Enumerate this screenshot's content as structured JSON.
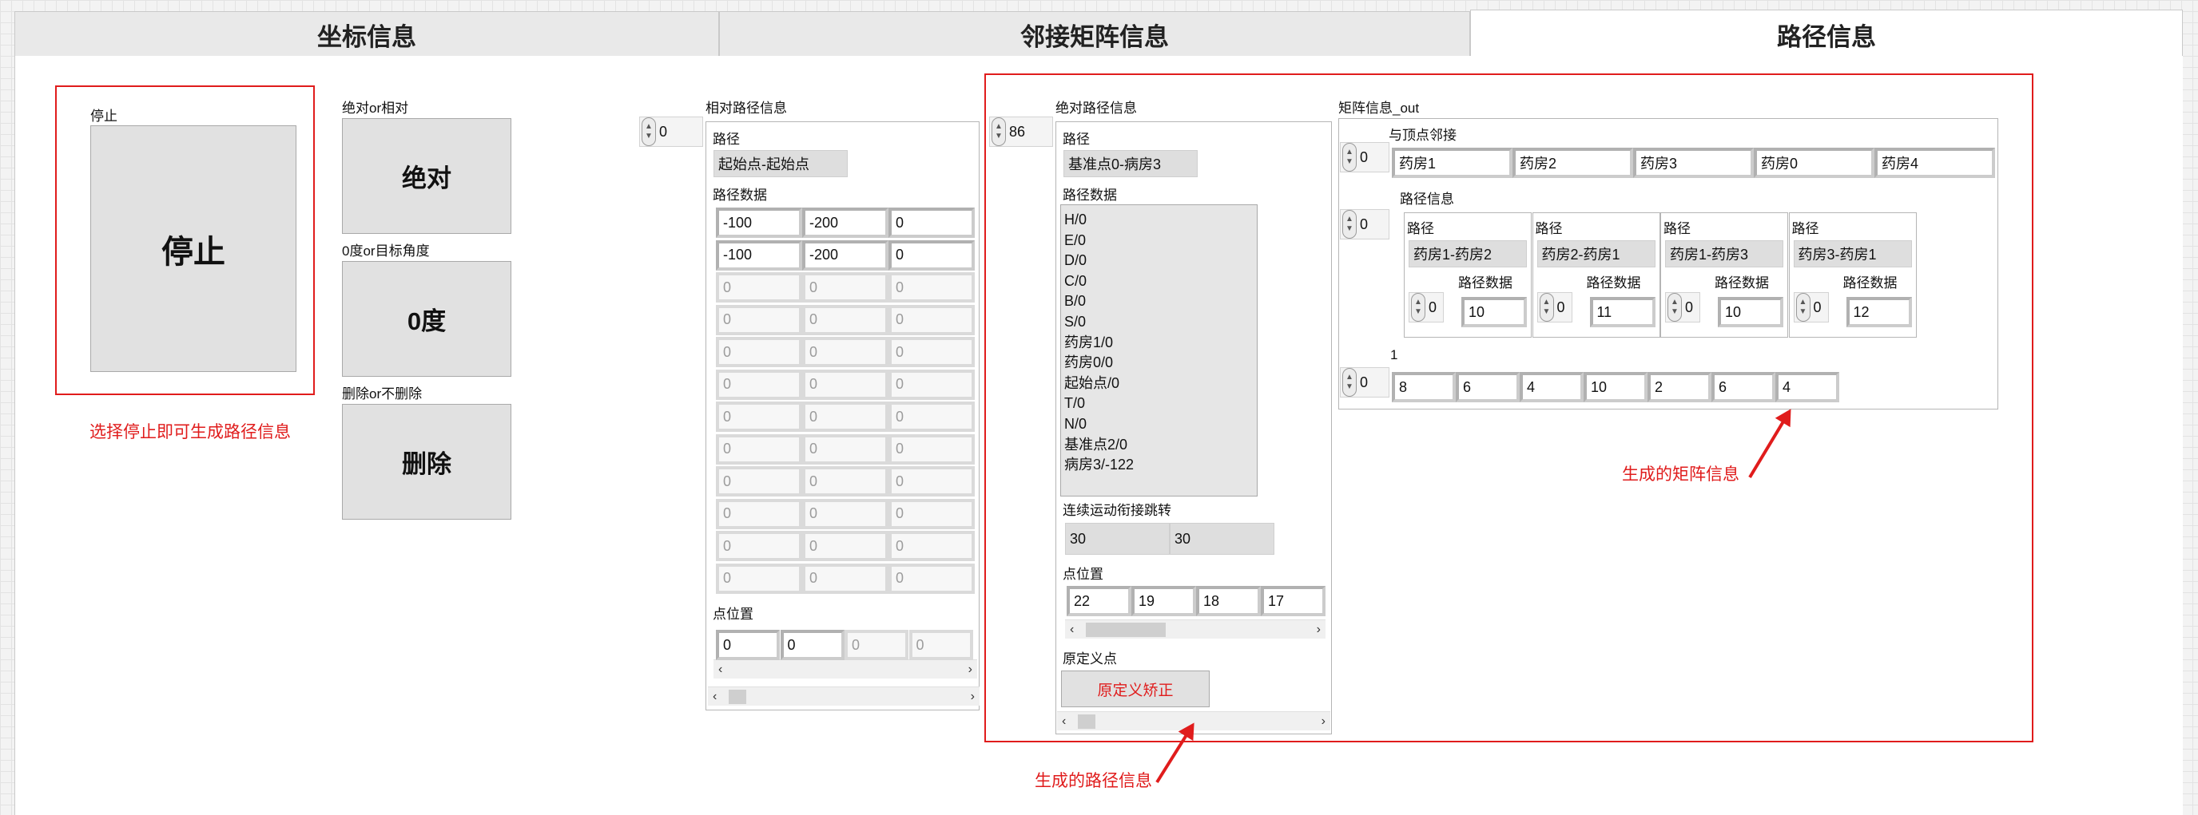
{
  "tabs": [
    {
      "label": "坐标信息"
    },
    {
      "label": "邻接矩阵信息"
    },
    {
      "label": "路径信息"
    }
  ],
  "controls": {
    "stop_label": "停止",
    "stop_button": "停止",
    "abs_rel_label": "绝对or相对",
    "abs_rel_button": "绝对",
    "angle_label": "0度or目标角度",
    "angle_button": "0度",
    "delete_label": "删除or不删除",
    "delete_button": "删除",
    "hint": "选择停止即可生成路径信息"
  },
  "relative": {
    "title": "相对路径信息",
    "index": "0",
    "path_label": "路径",
    "path_value": "起始点-起始点",
    "data_label": "路径数据",
    "rows": [
      [
        "-100",
        "-200",
        "0"
      ],
      [
        "-100",
        "-200",
        "0"
      ],
      [
        "0",
        "0",
        "0"
      ],
      [
        "0",
        "0",
        "0"
      ],
      [
        "0",
        "0",
        "0"
      ],
      [
        "0",
        "0",
        "0"
      ],
      [
        "0",
        "0",
        "0"
      ],
      [
        "0",
        "0",
        "0"
      ],
      [
        "0",
        "0",
        "0"
      ],
      [
        "0",
        "0",
        "0"
      ],
      [
        "0",
        "0",
        "0"
      ],
      [
        "0",
        "0",
        "0"
      ]
    ],
    "points_label": "点位置",
    "points": [
      "0",
      "0",
      "0",
      "0"
    ]
  },
  "absolute": {
    "title": "绝对路径信息",
    "index": "86",
    "path_label": "路径",
    "path_value": "基准点0-病房3",
    "data_label": "路径数据",
    "data_items": [
      "H/0",
      "E/0",
      "D/0",
      "C/0",
      "B/0",
      "S/0",
      "药房1/0",
      "药房0/0",
      "起始点/0",
      "T/0",
      "N/0",
      "基准点2/0",
      "病房3/-122"
    ],
    "jump_label": "连续运动衔接跳转",
    "jump_values": [
      "30",
      "30"
    ],
    "points_label": "点位置",
    "points": [
      "22",
      "19",
      "18",
      "17"
    ],
    "origin_label": "原定义点",
    "origin_button": "原定义矫正"
  },
  "matrix": {
    "title": "矩阵信息_out",
    "adj_label": "与顶点邻接",
    "adj_index": "0",
    "adj": [
      "药房1",
      "药房2",
      "药房3",
      "药房0",
      "药房4"
    ],
    "path_info_label": "路径信息",
    "path_info_index": "0",
    "paths": [
      {
        "label": "路径",
        "value": "药房1-药房2",
        "data_label": "路径数据",
        "idx": "0",
        "data": "10"
      },
      {
        "label": "路径",
        "value": "药房2-药房1",
        "data_label": "路径数据",
        "idx": "0",
        "data": "11"
      },
      {
        "label": "路径",
        "value": "药房1-药房3",
        "data_label": "路径数据",
        "idx": "0",
        "data": "10"
      },
      {
        "label": "路径",
        "value": "药房3-药房1",
        "data_label": "路径数据",
        "idx": "0",
        "data": "12"
      }
    ],
    "row_label": "1",
    "row_index": "0",
    "row_values": [
      "8",
      "6",
      "4",
      "10",
      "2",
      "6",
      "4"
    ]
  },
  "annotations": {
    "matrix_note": "生成的矩阵信息",
    "path_note": "生成的路径信息"
  },
  "colors": {
    "annotation": "#e01c1c",
    "selection_handle": "#1a6fd6"
  }
}
